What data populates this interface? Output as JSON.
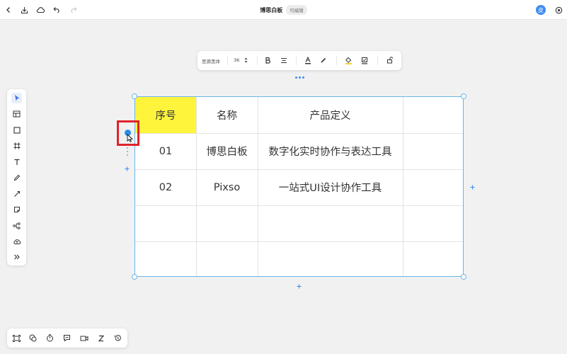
{
  "topbar": {
    "title": "博思白板",
    "badge": "可编辑",
    "avatar_text": "皮"
  },
  "format_toolbar": {
    "font_name": "思源黑体",
    "font_size": "36"
  },
  "table": {
    "headers": [
      "序号",
      "名称",
      "产品定义",
      ""
    ],
    "rows": [
      [
        "01",
        "博思白板",
        "数字化实时协作与表达工具",
        ""
      ],
      [
        "02",
        "Pixso",
        "一站式UI设计协作工具",
        ""
      ],
      [
        "",
        "",
        "",
        ""
      ],
      [
        "",
        "",
        "",
        ""
      ]
    ]
  },
  "colors": {
    "accent": "#3f8cf0",
    "selection": "#6bb6e6",
    "highlight_fill": "#fff43c",
    "annotation_box": "#e0232b"
  },
  "icons": {
    "topbar_left": [
      "back-icon",
      "download-icon",
      "cloud-icon",
      "undo-icon",
      "redo-icon"
    ],
    "topbar_right": [
      "settings-icon"
    ],
    "left_toolbar": [
      "pointer-icon",
      "table-icon",
      "rectangle-icon",
      "frame-icon",
      "text-icon",
      "pen-icon",
      "line-icon",
      "sticky-note-icon",
      "mindmap-icon",
      "upload-icon",
      "more-icon"
    ],
    "bottom_toolbar": [
      "fit-screen-icon",
      "comment-icon",
      "timer-icon",
      "chat-icon",
      "video-icon",
      "z-icon",
      "history-icon"
    ]
  }
}
